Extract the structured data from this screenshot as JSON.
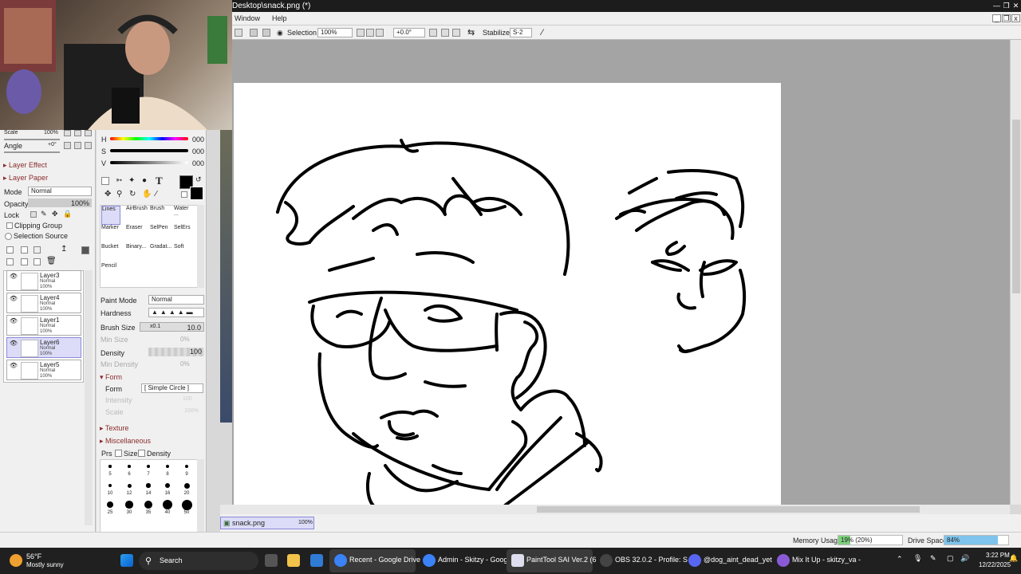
{
  "window": {
    "title": "Desktop\\snack.png (*)"
  },
  "menu": {
    "window": "Window",
    "help": "Help"
  },
  "toolbar": {
    "selection_label": "Selection",
    "zoom": "100%",
    "rotation": "+0.0°",
    "stabilizer_label": "Stabilizer",
    "stabilizer_value": "S-2"
  },
  "navigator": {
    "scale_label": "Scale",
    "scale_value": "100%",
    "angle_label": "Angle",
    "angle_value": "+0°"
  },
  "layer_panel": {
    "layer_effect": "Layer Effect",
    "layer_paper": "Layer Paper",
    "mode_label": "Mode",
    "mode_value": "Normal",
    "opacity_label": "Opacity",
    "opacity_value": "100%",
    "lock_label": "Lock",
    "clipping_group": "Clipping Group",
    "selection_source": "Selection Source",
    "layers": [
      {
        "name": "Layer3",
        "mode": "Normal",
        "opacity": "100%"
      },
      {
        "name": "Layer4",
        "mode": "Normal",
        "opacity": "100%"
      },
      {
        "name": "Layer1",
        "mode": "Normal",
        "opacity": "100%"
      },
      {
        "name": "Layer6",
        "mode": "Normal",
        "opacity": "100%"
      },
      {
        "name": "Layer5",
        "mode": "Normal",
        "opacity": "100%"
      }
    ]
  },
  "color": {
    "h_label": "H",
    "h_value": "000",
    "s_label": "S",
    "s_value": "000",
    "v_label": "V",
    "v_value": "000",
    "text_tool": "T"
  },
  "tools": [
    {
      "label": "Lines"
    },
    {
      "label": "AirBrush"
    },
    {
      "label": "Brush"
    },
    {
      "label": "Water ..."
    },
    {
      "label": "Marker"
    },
    {
      "label": "Eraser"
    },
    {
      "label": "SelPen"
    },
    {
      "label": "SelErs"
    },
    {
      "label": "Bucket"
    },
    {
      "label": "Binary..."
    },
    {
      "label": "Gradat..."
    },
    {
      "label": "Soft"
    },
    {
      "label": "Pencil"
    }
  ],
  "brush_settings": {
    "paint_mode_label": "Paint Mode",
    "paint_mode_value": "Normal",
    "hardness_label": "Hardness",
    "brush_size_label": "Brush Size",
    "brush_size_mult": "x0.1",
    "brush_size_value": "10.0",
    "min_size_label": "Min Size",
    "min_size_value": "0%",
    "density_label": "Density",
    "density_value": "100",
    "min_density_label": "Min Density",
    "min_density_value": "0%",
    "form_section": "Form",
    "form_label": "Form",
    "form_value": "[ Simple Circle ]",
    "intensity_label": "Intensity",
    "intensity_value": "100",
    "scale_label": "Scale",
    "scale_value": "100%",
    "texture_section": "Texture",
    "misc_section": "Miscellaneous",
    "prs_label": "Prs",
    "size_label": "Size",
    "density_check_label": "Density",
    "size_presets": [
      "5",
      "6",
      "7",
      "8",
      "9",
      "10",
      "12",
      "14",
      "16",
      "20",
      "25",
      "30",
      "35",
      "40",
      "50"
    ]
  },
  "document_tab": {
    "name": "snack.png",
    "zoom": "100%"
  },
  "status": {
    "memory_label": "Memory Usage",
    "memory_value": "19% (20%)",
    "memory_fraction": 0.19,
    "drive_label": "Drive Space",
    "drive_value": "84%",
    "drive_fraction": 0.84
  },
  "taskbar": {
    "weather_temp": "56°F",
    "weather_desc": "Mostly sunny",
    "search": "Search",
    "items": [
      {
        "label": "Recent - Google Drive"
      },
      {
        "label": "Admin - Skitzy - Goog"
      },
      {
        "label": "PaintTool SAI Ver.2 (6"
      },
      {
        "label": "OBS 32.0.2 - Profile: S"
      },
      {
        "label": "@dog_aint_dead_yet"
      },
      {
        "label": "Mix It Up - skitzy_va -"
      }
    ],
    "time": "3:22 PM",
    "date": "12/22/2025"
  }
}
